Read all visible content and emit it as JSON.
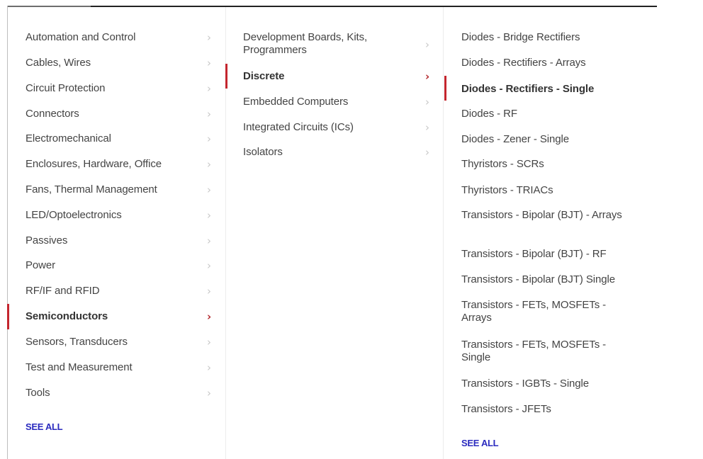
{
  "colors": {
    "accent_red": "#c4262e",
    "link_blue": "#2b2bbf",
    "text": "#444444",
    "chevron": "#c8c8c8"
  },
  "categories": {
    "items": [
      {
        "label": "Automation and Control",
        "icon": "chevron-right-icon"
      },
      {
        "label": "Cables, Wires",
        "icon": "chevron-right-icon"
      },
      {
        "label": "Circuit Protection",
        "icon": "chevron-right-icon"
      },
      {
        "label": "Connectors",
        "icon": "chevron-right-icon"
      },
      {
        "label": "Electromechanical",
        "icon": "chevron-right-icon"
      },
      {
        "label": "Enclosures, Hardware, Office",
        "icon": "chevron-right-icon"
      },
      {
        "label": "Fans, Thermal Management",
        "icon": "chevron-right-icon"
      },
      {
        "label": "LED/Optoelectronics",
        "icon": "chevron-right-icon"
      },
      {
        "label": "Passives",
        "icon": "chevron-right-icon"
      },
      {
        "label": "Power",
        "icon": "chevron-right-icon"
      },
      {
        "label": "RF/IF and RFID",
        "icon": "chevron-right-icon"
      },
      {
        "label": "Semiconductors",
        "icon": "chevron-right-icon",
        "active": true
      },
      {
        "label": "Sensors, Transducers",
        "icon": "chevron-right-icon"
      },
      {
        "label": "Test and Measurement",
        "icon": "chevron-right-icon"
      },
      {
        "label": "Tools",
        "icon": "chevron-right-icon"
      }
    ],
    "see_all": "SEE ALL",
    "chevron_glyph": "›"
  },
  "subcategories": {
    "items": [
      {
        "label": "Development Boards, Kits, Programmers",
        "icon": "chevron-right-icon"
      },
      {
        "label": "Discrete",
        "icon": "chevron-right-icon",
        "active": true
      },
      {
        "label": "Embedded Computers",
        "icon": "chevron-right-icon"
      },
      {
        "label": "Integrated Circuits (ICs)",
        "icon": "chevron-right-icon"
      },
      {
        "label": "Isolators",
        "icon": "chevron-right-icon"
      }
    ],
    "chevron_glyph": "›"
  },
  "product_types": {
    "items": [
      {
        "label": "Diodes - Bridge Rectifiers"
      },
      {
        "label": "Diodes - Rectifiers - Arrays"
      },
      {
        "label": "Diodes - Rectifiers - Single",
        "active": true
      },
      {
        "label": "Diodes - RF"
      },
      {
        "label": "Diodes - Zener - Single"
      },
      {
        "label": "Thyristors - SCRs"
      },
      {
        "label": "Thyristors - TRIACs"
      },
      {
        "label": "Transistors - Bipolar (BJT) - Arrays"
      },
      {
        "label": "Transistors - Bipolar (BJT) - RF"
      },
      {
        "label": "Transistors - Bipolar (BJT) Single"
      },
      {
        "label": "Transistors - FETs, MOSFETs - Arrays"
      },
      {
        "label": "Transistors - FETs, MOSFETs - Single"
      },
      {
        "label": "Transistors - IGBTs - Single"
      },
      {
        "label": "Transistors - JFETs"
      }
    ],
    "see_all": "SEE ALL"
  }
}
